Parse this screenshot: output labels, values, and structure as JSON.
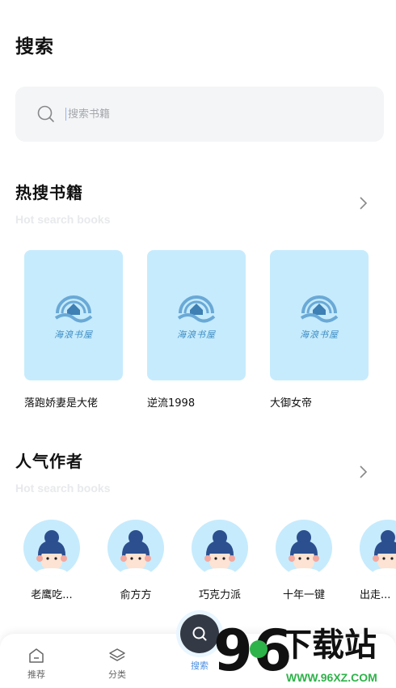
{
  "page": {
    "title": "搜索"
  },
  "search": {
    "placeholder": "搜索书籍"
  },
  "hot_books": {
    "title": "热搜书籍",
    "subtitle": "Hot search books",
    "cover_logo_text": "海浪书屋",
    "items": [
      {
        "title": "落跑娇妻是大佬"
      },
      {
        "title": "逆流1998"
      },
      {
        "title": "大御女帝"
      }
    ]
  },
  "popular_authors": {
    "title": "人气作者",
    "subtitle": "Hot search books",
    "items": [
      {
        "name": "老鹰吃..."
      },
      {
        "name": "俞方方"
      },
      {
        "name": "巧克力派"
      },
      {
        "name": "十年一键"
      },
      {
        "name": "出走..."
      }
    ]
  },
  "tabbar": {
    "home": "推荐",
    "category": "分类",
    "search": "搜索"
  },
  "watermark": {
    "brand": "下载站",
    "number": "96",
    "url": "WWW.96XZ.COM"
  },
  "colors": {
    "cover_bg": "#c6ebfd",
    "active_tab": "#4a8de3",
    "search_bg": "#f4f5f7"
  }
}
